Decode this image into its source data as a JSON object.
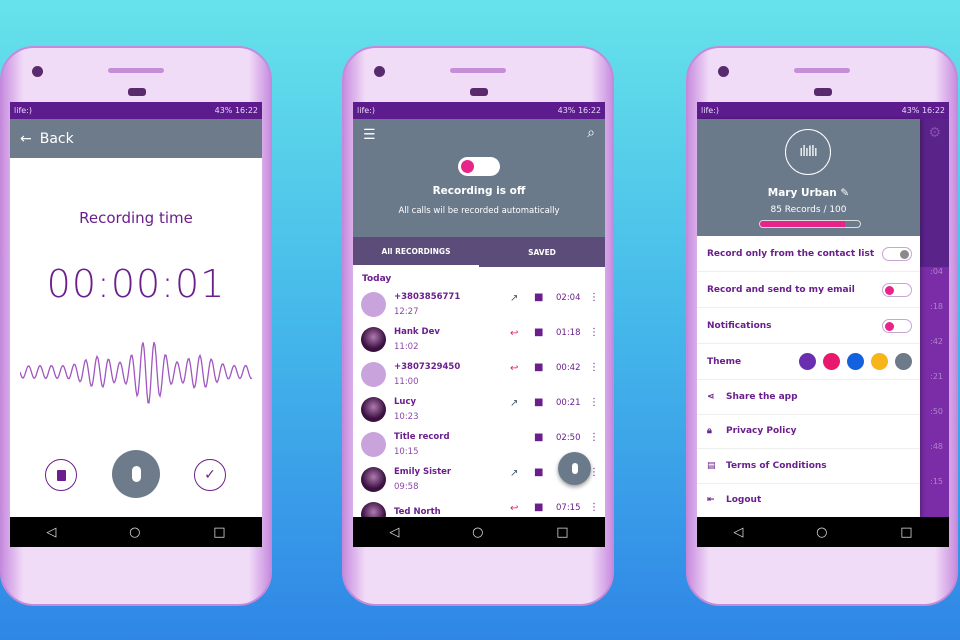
{
  "status_bar": {
    "carrier": "life:)",
    "battery": "43%",
    "time": "16:22"
  },
  "phone1": {
    "back_label": "Back",
    "title": "Recording time",
    "timer": "00:00:01"
  },
  "phone2": {
    "toggle_on": false,
    "status_title": "Recording is off",
    "status_subtitle": "All calls wil be recorded automatically",
    "tabs": [
      {
        "label": "All RECORDINGS",
        "active": true
      },
      {
        "label": "SAVED",
        "active": false
      }
    ],
    "section": "Today",
    "items": [
      {
        "name": "+3803856771",
        "time": "12:27",
        "duration": "02:04",
        "call": "outgoing",
        "avatar": "placeholder"
      },
      {
        "name": "Hank Dev",
        "time": "11:02",
        "duration": "01:18",
        "call": "missed",
        "avatar": "photo"
      },
      {
        "name": "+3807329450",
        "time": "11:00",
        "duration": "00:42",
        "call": "missed",
        "avatar": "placeholder"
      },
      {
        "name": "Lucy",
        "time": "10:23",
        "duration": "00:21",
        "call": "outgoing",
        "avatar": "photo"
      },
      {
        "name": "Title record",
        "time": "10:15",
        "duration": "02:50",
        "call": "",
        "avatar": "mic"
      },
      {
        "name": "Emily Sister",
        "time": "09:58",
        "duration": "",
        "call": "outgoing",
        "avatar": "photo"
      },
      {
        "name": "Ted North",
        "time": "",
        "duration": "07:15",
        "call": "missed",
        "avatar": "photo"
      }
    ]
  },
  "phone3": {
    "user_name": "Mary Urban",
    "records_label": "85 Records / 100",
    "records_progress": 0.85,
    "settings": [
      {
        "label": "Record only from the contact list",
        "on": false
      },
      {
        "label": "Record and send to my email",
        "on": true
      },
      {
        "label": "Notifications",
        "on": true
      }
    ],
    "theme_label": "Theme",
    "theme_colors": [
      "#6a2eb0",
      "#e8186f",
      "#1161e0",
      "#f8b418",
      "#6d7a8a"
    ],
    "menu": [
      {
        "label": "Share the app",
        "icon": "share-icon"
      },
      {
        "label": "Privacy Policy",
        "icon": "lock-icon"
      },
      {
        "label": "Terms of Conditions",
        "icon": "document-icon"
      },
      {
        "label": "Logout",
        "icon": "logout-icon"
      }
    ],
    "behind_durations": [
      ":04",
      ":18",
      ":42",
      ":21",
      ":50",
      ":48",
      ":15"
    ]
  }
}
